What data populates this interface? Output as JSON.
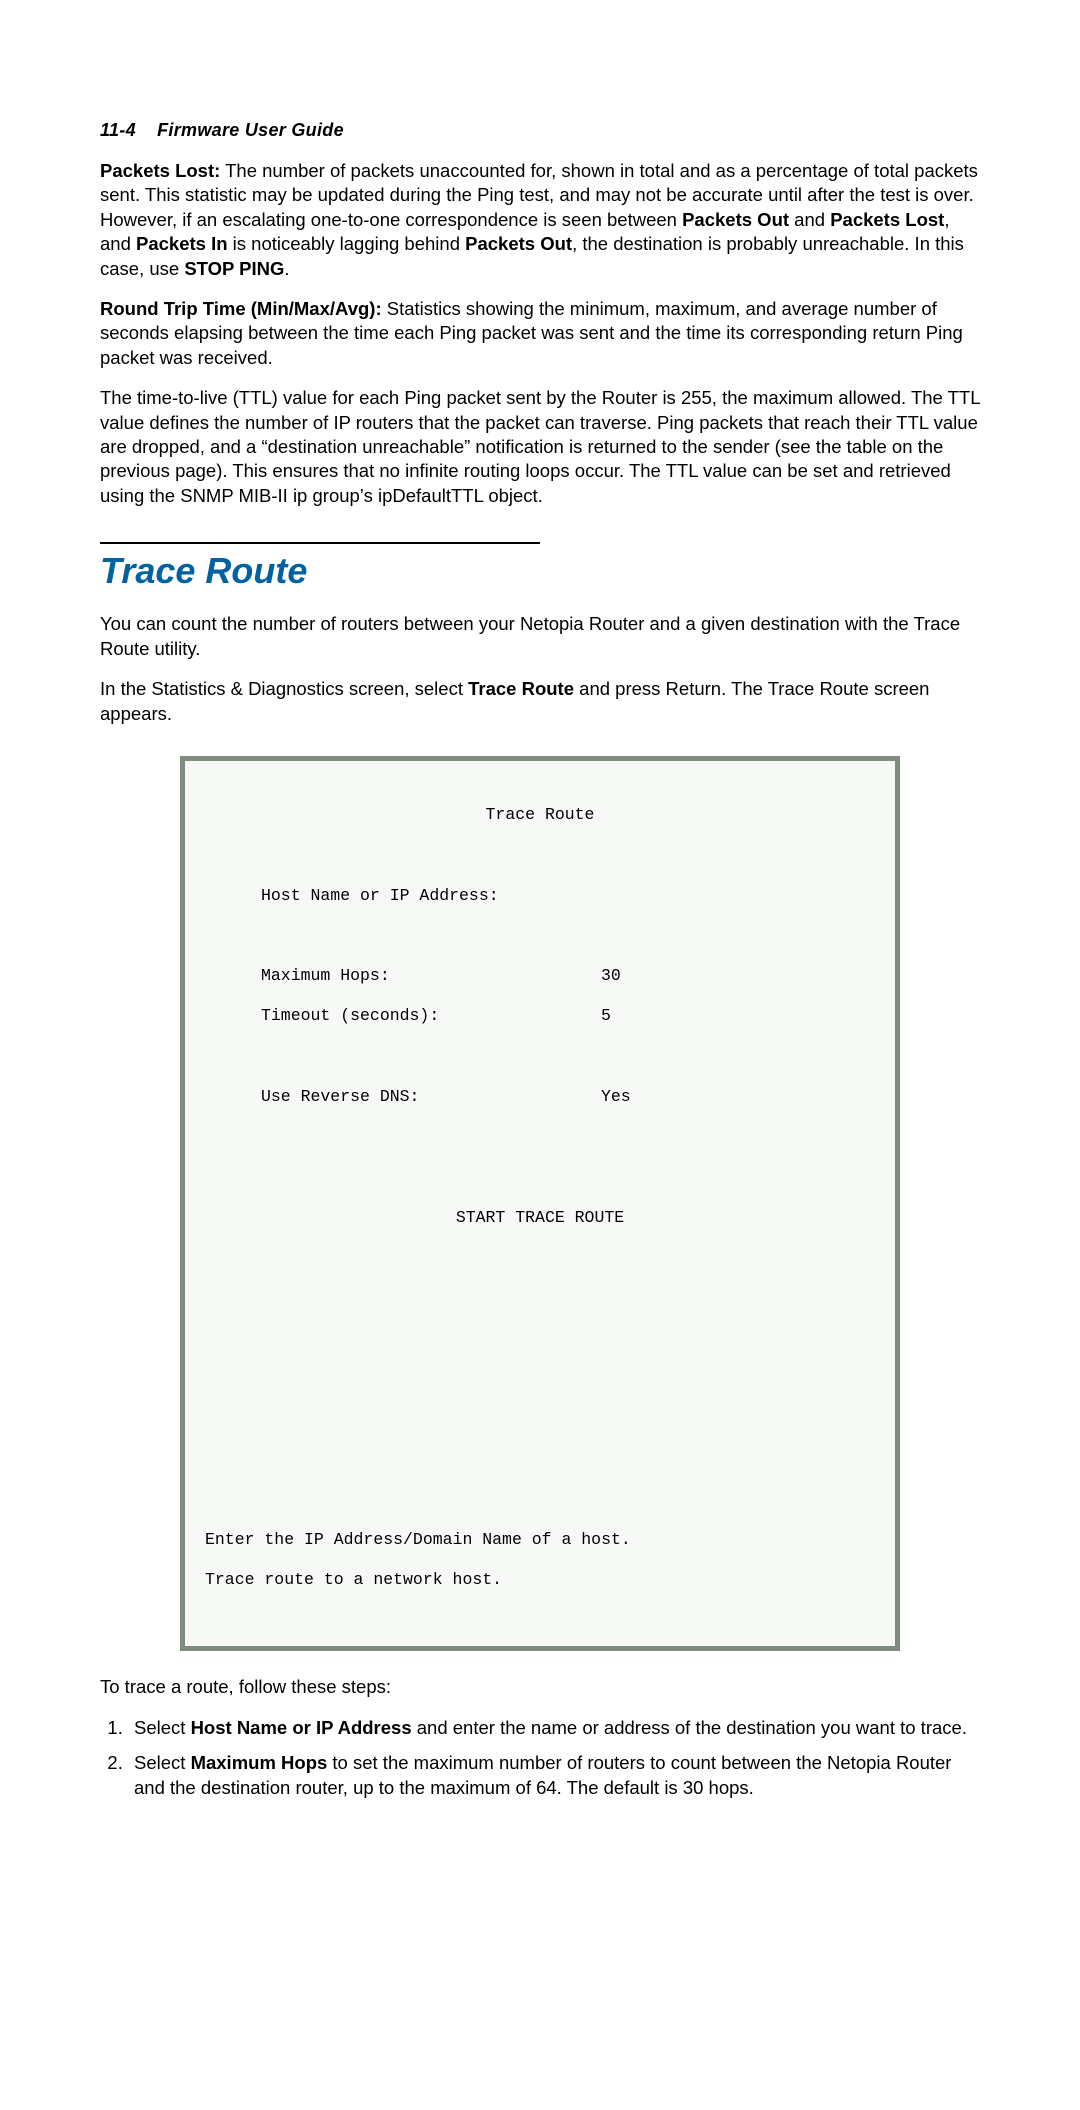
{
  "header": {
    "page_number": "11-4",
    "title": "Firmware User Guide"
  },
  "para1": {
    "lead_label": "Packets Lost:",
    "text_a": "  The number of packets unaccounted for, shown in total and as a percentage of total packets sent. This statistic may be updated during the Ping test, and may not be accurate until after the test is over. However, if an escalating one-to-one correspondence is seen between ",
    "bold1": "Packets Out",
    "text_b": " and ",
    "bold2": "Packets Lost",
    "text_c": ", and ",
    "bold3": "Packets In",
    "text_d": " is noticeably lagging behind ",
    "bold4": "Packets Out",
    "text_e": ", the destination is probably unreachable. In this case, use ",
    "bold5": "STOP PING",
    "text_f": "."
  },
  "para2": {
    "lead_label": "Round Trip Time (Min/Max/Avg):",
    "text": "  Statistics showing the minimum, maximum, and average number of seconds elapsing between the time each Ping packet was sent and the time its corresponding return Ping packet was received."
  },
  "para3": {
    "text": "The time-to-live (TTL) value for each Ping packet sent by the Router is 255, the maximum allowed. The TTL value defines the number of IP routers that the packet can traverse. Ping packets that reach their TTL value are dropped, and a “destination unreachable” notification is returned to the sender (see the table on the previous page). This ensures that no infinite routing loops occur. The TTL value can be set and retrieved using the SNMP MIB-II ip group’s ipDefaultTTL object."
  },
  "section": {
    "heading": "Trace Route"
  },
  "para4": {
    "text": "You can count the number of routers between your Netopia Router and a given destination with the Trace Route utility."
  },
  "para5": {
    "text_a": "In the Statistics & Diagnostics screen, select ",
    "bold1": "Trace Route",
    "text_b": " and press Return. The Trace Route screen appears."
  },
  "terminal": {
    "title": "Trace Route",
    "host_field_label": "Host Name or IP Address:",
    "max_hops_label": "Maximum Hops:",
    "max_hops_value": "30",
    "timeout_label": "Timeout (seconds):",
    "timeout_value": "5",
    "reverse_dns_label": "Use Reverse DNS:",
    "reverse_dns_value": "Yes",
    "start_button": "START TRACE ROUTE",
    "footer_line1": "Enter the IP Address/Domain Name of a host.",
    "footer_line2": "Trace route to a network host."
  },
  "para6": {
    "text": "To trace a route, follow these steps:"
  },
  "steps": {
    "1": {
      "text_a": "Select ",
      "bold1": "Host Name or IP Address",
      "text_b": " and enter the name or address of the destination you want to trace."
    },
    "2": {
      "text_a": "Select ",
      "bold1": "Maximum Hops",
      "text_b": " to set the maximum number of routers to count between the Netopia Router and the destination router, up to the maximum of 64. The default is 30 hops."
    }
  }
}
